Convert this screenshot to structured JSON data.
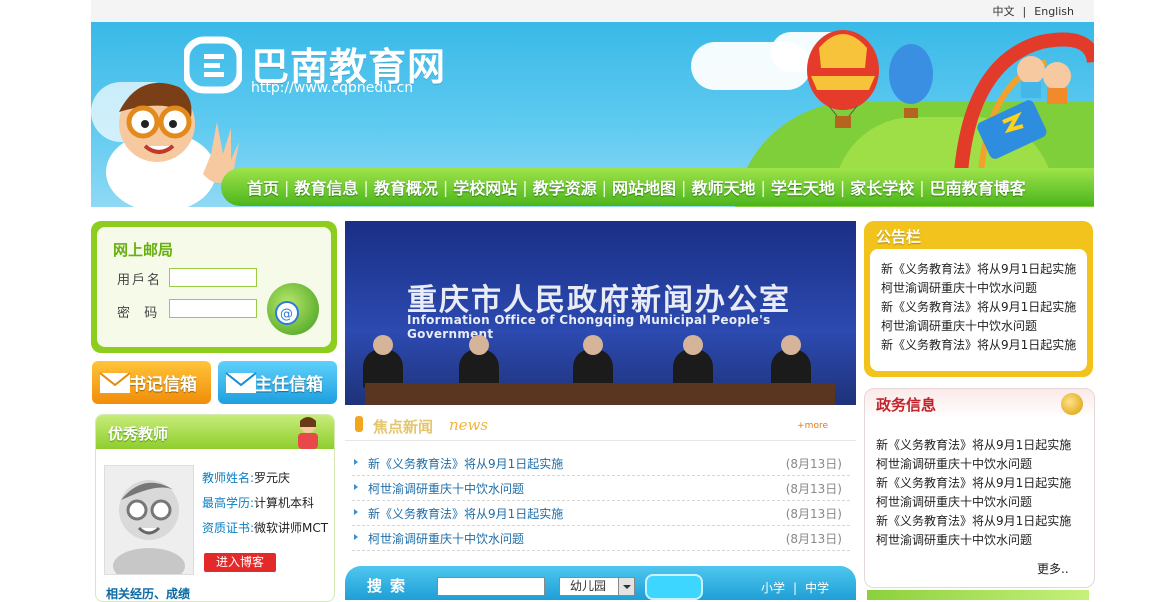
{
  "header": {
    "lang_zh": "中文",
    "lang_sep": "|",
    "lang_en": "English",
    "site_title": "巴南教育网",
    "site_url": "http://www.cqbnedu.cn"
  },
  "nav": {
    "items": [
      "首页",
      "教育信息",
      "教育概况",
      "学校网站",
      "教学资源",
      "网站地图",
      "教师天地",
      "学生天地",
      "家长学校",
      "巴南教育博客"
    ]
  },
  "mailbox": {
    "title": "网上邮局",
    "user_label": "用戶名",
    "pass_label": "密  码",
    "user_value": "",
    "pass_value": ""
  },
  "mail_buttons": {
    "secretary": "书记信箱",
    "director": "主任信箱"
  },
  "teacher": {
    "section_title": "优秀教师",
    "name_key": "教师姓名:",
    "name_val": "罗元庆",
    "edu_key": "最高学历:",
    "edu_val": "计算机本科",
    "cert_key": "资质证书:",
    "cert_val": "微软讲师MCT",
    "blog_btn": "进入博客",
    "footer": "相关经历、成绩"
  },
  "photo": {
    "title": "重庆市人民政府新闻办公室",
    "subtitle": "Information Office of Chongqing Municipal People's Government"
  },
  "news": {
    "title": "焦点新闻",
    "title_en": "news",
    "more": "+more",
    "items": [
      {
        "text": "新《义务教育法》将从9月1日起实施",
        "date": "(8月13日)"
      },
      {
        "text": "柯世渝调研重庆十中饮水问题",
        "date": "(8月13日)"
      },
      {
        "text": "新《义务教育法》将从9月1日起实施",
        "date": "(8月13日)"
      },
      {
        "text": "柯世渝调研重庆十中饮水问题",
        "date": "(8月13日)"
      }
    ]
  },
  "search": {
    "label": "搜索",
    "input_value": "",
    "select_value": "幼儿园",
    "link1": "小学",
    "sep": "|",
    "link2": "中学"
  },
  "notice": {
    "title": "公告栏",
    "items": [
      "新《义务教育法》将从9月1日起实施",
      "柯世渝调研重庆十中饮水问题",
      "新《义务教育法》将从9月1日起实施",
      "柯世渝调研重庆十中饮水问题",
      "新《义务教育法》将从9月1日起实施"
    ]
  },
  "gov": {
    "title": "政务信息",
    "items": [
      "新《义务教育法》将从9月1日起实施",
      "柯世渝调研重庆十中饮水问题",
      "新《义务教育法》将从9月1日起实施",
      "柯世渝调研重庆十中饮水问题",
      "新《义务教育法》将从9月1日起实施",
      "柯世渝调研重庆十中饮水问题"
    ],
    "more": "更多.."
  },
  "colors": {
    "nav_green": "#4cb51c",
    "sky_blue": "#39b9e7",
    "notice_yellow": "#f1c31c",
    "gov_red": "#c2232a"
  },
  "icons": [
    "mail-globe-icon",
    "envelope-icon",
    "hot-air-balloon-icon",
    "medal-icon",
    "teacher-avatar-icon",
    "dropdown-arrow-icon"
  ]
}
